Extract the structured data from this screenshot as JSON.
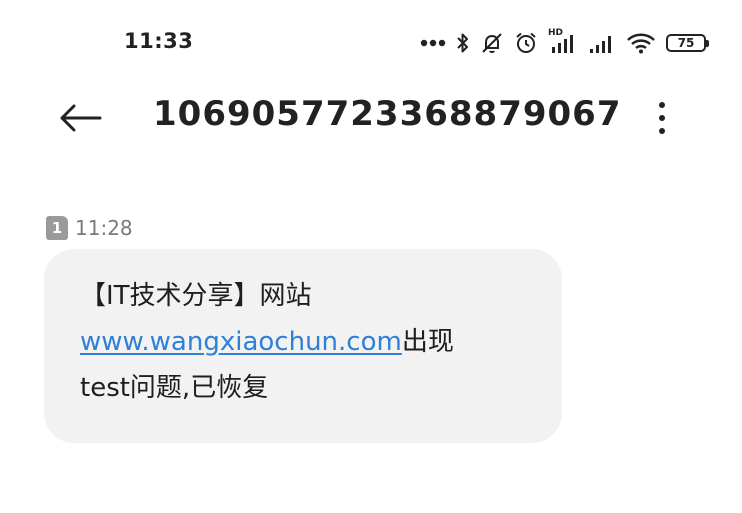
{
  "status_bar": {
    "time": "11:33",
    "battery_level": "75",
    "icons": [
      "more-dots-icon",
      "bluetooth-icon",
      "mute-icon",
      "alarm-icon",
      "hd-signal-icon",
      "signal-icon",
      "wifi-icon",
      "battery-icon"
    ],
    "hd_label": "HD"
  },
  "header": {
    "title": "1069057723368879067",
    "back_icon": "back-arrow-icon",
    "more_icon": "more-vert-icon"
  },
  "message": {
    "sim_label": "1",
    "time": "11:28",
    "line1": "【IT技术分享】网站",
    "link_text": "www.wangxiaochun.com",
    "line2_suffix": "出现",
    "line3": "test问题,已恢复"
  },
  "colors": {
    "bubble_background": "#f2f2f2",
    "link": "#2f80d6",
    "meta_text": "#7a7a7a"
  }
}
